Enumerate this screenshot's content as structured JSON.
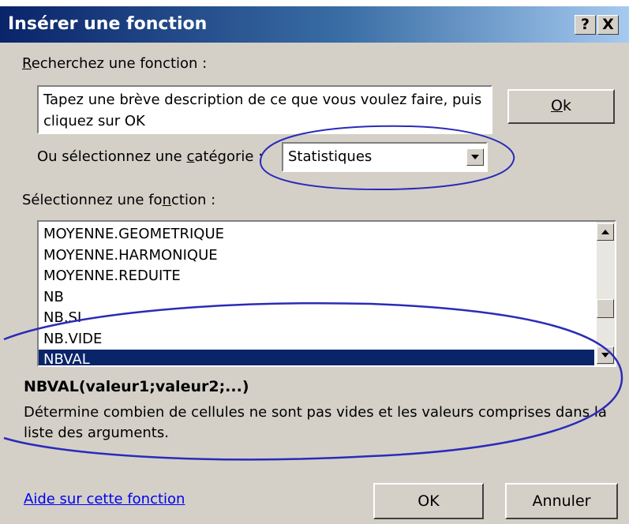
{
  "dialog": {
    "title": "Insérer une fonction",
    "help_button": "?",
    "close_button": "X"
  },
  "search": {
    "label_prefix": "",
    "label_underlined": "R",
    "label_rest": "echerchez une fonction :",
    "text": "Tapez une brève description de ce que vous voulez faire, puis cliquez sur OK",
    "go_prefix": "",
    "go_underlined": "O",
    "go_rest": "k"
  },
  "category": {
    "label_prefix": "Ou sélectionnez une ",
    "label_underlined": "c",
    "label_rest": "atégorie :",
    "value": "Statistiques"
  },
  "functions": {
    "label_prefix": "Sélectionnez une fo",
    "label_underlined": "n",
    "label_rest": "ction :",
    "items": [
      {
        "label": "MOYENNE.GEOMETRIQUE",
        "selected": false
      },
      {
        "label": "MOYENNE.HARMONIQUE",
        "selected": false
      },
      {
        "label": "MOYENNE.REDUITE",
        "selected": false
      },
      {
        "label": "NB",
        "selected": false
      },
      {
        "label": "NB.SI",
        "selected": false
      },
      {
        "label": "NB.VIDE",
        "selected": false
      },
      {
        "label": "NBVAL",
        "selected": true
      }
    ]
  },
  "description": {
    "syntax": "NBVAL(valeur1;valeur2;...)",
    "text": "Détermine combien de cellules ne sont pas vides et les valeurs comprises dans la liste des arguments."
  },
  "footer": {
    "help_link": "Aide sur cette fonction",
    "ok_label": "OK",
    "cancel_label": "Annuler"
  },
  "colors": {
    "dialog_face": "#d4d0c8",
    "title_start": "#0a246a",
    "title_end": "#a6caf0",
    "selection": "#0a246a",
    "annotation": "#2b2bb8",
    "link": "#0000ee"
  }
}
